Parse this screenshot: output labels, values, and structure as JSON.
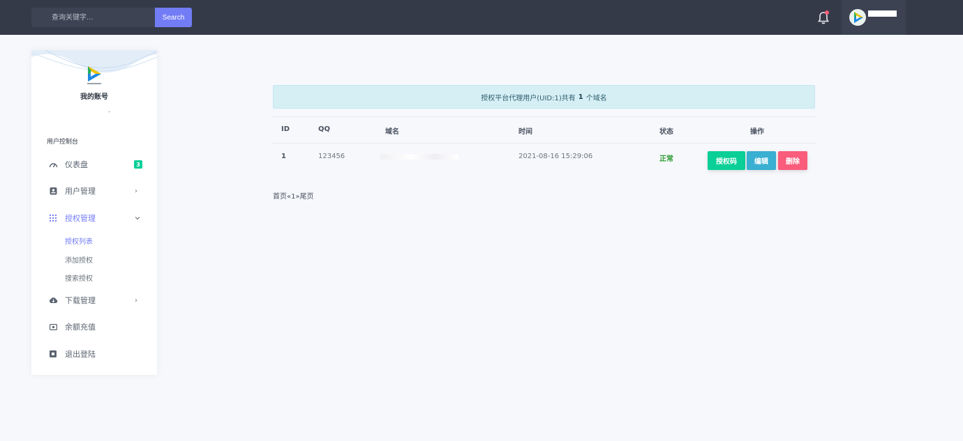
{
  "topbar": {
    "search": {
      "placeholder": "查询关键字...",
      "button_label": "Search"
    },
    "icons": {
      "notification": "bell-icon",
      "avatar": "avatar"
    }
  },
  "sidebar": {
    "account_title": "我的账号",
    "section_label": "用户控制台",
    "items": [
      {
        "label": "仪表盘",
        "icon": "dashboard-gauge-icon",
        "badge": "3"
      },
      {
        "label": "用户管理",
        "icon": "user-card-icon"
      },
      {
        "label": "授权管理",
        "icon": "grid-icon"
      },
      {
        "label": "下载管理",
        "icon": "cloud-download-icon"
      },
      {
        "label": "余额充值",
        "icon": "money-icon"
      },
      {
        "label": "退出登陆",
        "icon": "logout-icon"
      }
    ],
    "sub_items": [
      "授权列表",
      "添加授权",
      "搜索授权"
    ]
  },
  "main": {
    "alert": {
      "prefix": "授权平台代理用户(UID:1)共有",
      "count": "1",
      "suffix": "个域名"
    },
    "table": {
      "headers": [
        "ID",
        "QQ",
        "域名",
        "时间",
        "状态",
        "操作"
      ],
      "rows": [
        {
          "id": "1",
          "qq": "123456",
          "time": "2021-08-16 15:29:06",
          "status": "正常"
        }
      ],
      "actions": [
        "授权码",
        "编辑",
        "删除"
      ]
    },
    "pagination": "首页«1»尾页"
  },
  "colors": {
    "topbar": "#343a48",
    "primary": "#727cf5",
    "success": "#0acf97",
    "info": "#39afd1",
    "danger": "#fa5c7c",
    "status_ok": "#2f9d35"
  }
}
